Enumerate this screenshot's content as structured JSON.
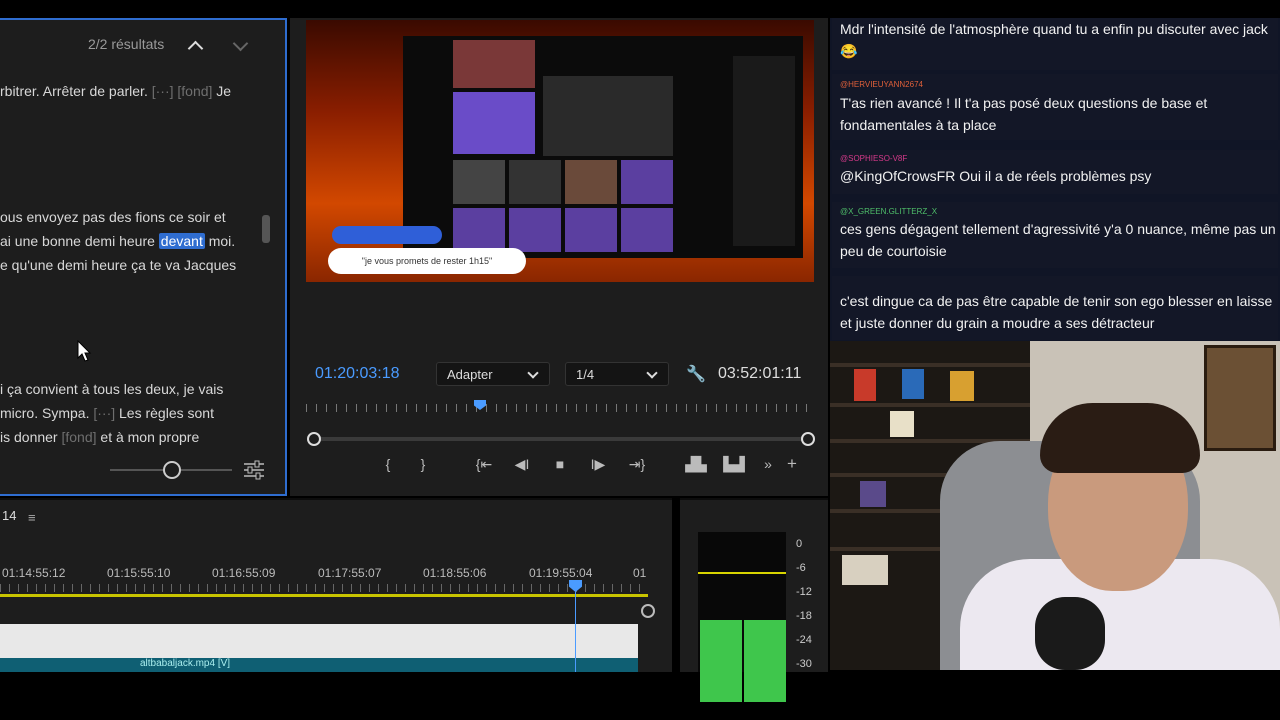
{
  "transcript": {
    "search_count": "2/2 résultats",
    "lines": [
      {
        "pre": "rbitrer. Arrêter de parler. ",
        "dim": "[···] [fond]",
        "post": " Je"
      },
      {
        "text": "ous envoyez pas des fions ce soir et"
      },
      {
        "pre": "ai une bonne demi heure ",
        "hl": "devant",
        "post": " moi."
      },
      {
        "text": "e qu'une demi heure ça te va Jacques"
      },
      {
        "text": "i ça convient à tous les deux, je vais"
      },
      {
        "pre": " micro. Sympa. ",
        "dim": "[···]",
        "post": " Les règles sont"
      },
      {
        "pre": "is donner ",
        "dim": "[fond]",
        "post": " et à mon propre"
      }
    ]
  },
  "monitor": {
    "timecode": "01:20:03:18",
    "fit_select": "Adapter",
    "res_select": "1/4",
    "duration": "03:52:01:11",
    "bubble_text": "\"je vous promets de rester 1h15\""
  },
  "transport": {
    "mark_in": "{",
    "mark_out": "}",
    "go_in": "{⇤",
    "step_back": "◀I",
    "stop": "■",
    "play": "I▶",
    "go_out": "⇥}",
    "lift": "▟▙",
    "extract": "▙▟",
    "more": "»",
    "add": "+"
  },
  "timeline": {
    "sequence_label": "14",
    "menu_glyph": "≡",
    "timecodes": [
      "01:14:55:12",
      "01:15:55:10",
      "01:16:55:09",
      "01:17:55:07",
      "01:18:55:06",
      "01:19:55:04",
      "01"
    ],
    "clip_label": "altbabaljack.mp4 [V]"
  },
  "meter": {
    "db_labels": [
      "0",
      "-6",
      "-12",
      "-18",
      "-24",
      "-30"
    ]
  },
  "chat": {
    "messages": [
      {
        "user": "",
        "text": "Mdr l'intensité de l'atmosphère quand tu a enfin pu discuter avec jack 😂"
      },
      {
        "user": "@HERVIEUYANN2674",
        "text": "T'as rien avancé ! Il t'a pas posé deux questions de base et fondamentales à ta place"
      },
      {
        "user": "@SOPHIESO-V8F",
        "text": "@KingOfCrowsFR Oui il a de réels problèmes psy"
      },
      {
        "user": "@X_GREEN.GLITTERZ_X",
        "text": "ces gens dégagent tellement d'agressivité y'a 0 nuance, même pas un peu de courtoisie"
      },
      {
        "user": "",
        "text": "c'est dingue ca de pas être capable de tenir son ego blesser en laisse et juste donner du grain a moudre a ses détracteur"
      }
    ]
  },
  "colors": {
    "accent": "#2f6dd0",
    "timecode": "#4a9bff",
    "meter_green": "#3fc64c",
    "work_area": "#c8c400",
    "user_orange": "#e0603a",
    "user_pink": "#d63a8a",
    "user_green": "#4fbf6a",
    "user_red": "#b03030"
  }
}
